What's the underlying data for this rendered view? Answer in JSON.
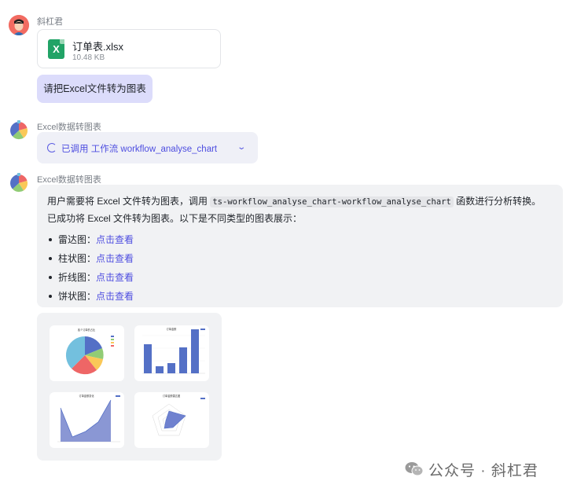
{
  "user": {
    "name": "斜杠君",
    "file": {
      "name": "订单表.xlsx",
      "size": "10.48 KB",
      "icon": "excel-file-icon"
    },
    "message": "请把Excel文件转为图表"
  },
  "bot": {
    "name": "Excel数据转图表",
    "workflow": {
      "label": "已调用 工作流 workflow_analyse_chart",
      "icon": "loading-spinner-icon",
      "toggle_icon": "chevron-down-icon"
    },
    "reply": {
      "text_before": "用户需要将 Excel 文件转为图表，调用 ",
      "code": "ts-workflow_analyse_chart-workflow_analyse_chart",
      "text_after": " 函数进行分析转换。已成功将 Excel 文件转为图表。以下是不同类型的图表展示：",
      "items": [
        {
          "label": "雷达图：",
          "link": "点击查看"
        },
        {
          "label": "柱状图：",
          "link": "点击查看"
        },
        {
          "label": "折线图：",
          "link": "点击查看"
        },
        {
          "label": "饼状图：",
          "link": "点击查看"
        }
      ]
    },
    "thumbnails": [
      {
        "name": "pie-chart-thumbnail",
        "title": "各个订单的占比"
      },
      {
        "name": "bar-chart-thumbnail",
        "title": "订单金额"
      },
      {
        "name": "area-chart-thumbnail",
        "title": "订单金额变化"
      },
      {
        "name": "radar-chart-thumbnail",
        "title": "订单金额雷达图"
      }
    ]
  },
  "watermark": {
    "text": "公众号 · 斜杠君",
    "icon": "wechat-icon"
  },
  "colors": {
    "accent": "#4f4fe0",
    "user_bubble": "#dcdcfb",
    "reply_bubble": "#f1f2f4",
    "chart_blue": "#5470c6"
  }
}
